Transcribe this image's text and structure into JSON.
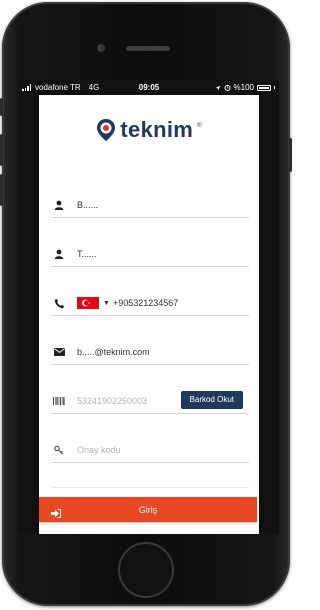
{
  "status_bar": {
    "carrier": "vodafone TR",
    "network": "4G",
    "time": "09:05",
    "battery": "%100"
  },
  "brand": {
    "name": "teknim",
    "mark": "®"
  },
  "form": {
    "first_name": "B......",
    "last_name": "T......",
    "country_flag": "turkey-flag",
    "phone": "+905321234567",
    "email": "b.....@teknim.com",
    "barcode_placeholder": "53241902250003",
    "barcode_button": "Barkod Okut",
    "code_placeholder": "Onay kodu",
    "submit_label": "Giriş"
  },
  "colors": {
    "brand_navy": "#1f3a5c",
    "logo_red": "#e2332a",
    "submit_red": "#e94824",
    "flag_red": "#e30a17"
  },
  "icons": [
    "user-icon",
    "phone-icon",
    "envelope-icon",
    "barcode-icon",
    "key-icon",
    "sign-in-icon"
  ]
}
